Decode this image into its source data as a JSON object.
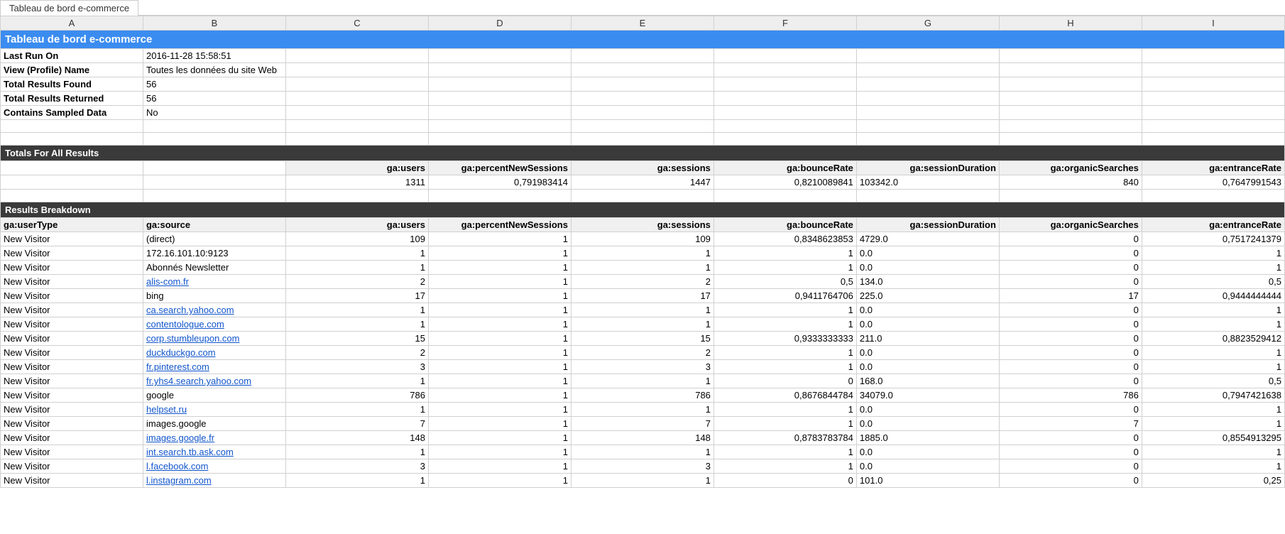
{
  "tab": "Tableau de bord e-commerce",
  "columns": [
    "A",
    "B",
    "C",
    "D",
    "E",
    "F",
    "G",
    "H",
    "I"
  ],
  "title": "Tableau de bord e-commerce",
  "meta": [
    {
      "label": "Last Run On",
      "value": "2016-11-28 15:58:51"
    },
    {
      "label": "View (Profile) Name",
      "value": "Toutes les données du site Web"
    },
    {
      "label": "Total Results Found",
      "value": "56"
    },
    {
      "label": "Total Results Returned",
      "value": "56"
    },
    {
      "label": "Contains Sampled Data",
      "value": "No"
    }
  ],
  "totals_header": "Totals For All Results",
  "metric_headers": [
    "ga:users",
    "ga:percentNewSessions",
    "ga:sessions",
    "ga:bounceRate",
    "ga:sessionDuration",
    "ga:organicSearches",
    "ga:entranceRate"
  ],
  "totals_values": [
    "1311",
    "0,791983414",
    "1447",
    "0,8210089841",
    "103342.0",
    "840",
    "0,7647991543"
  ],
  "breakdown_header": "Results Breakdown",
  "dim_headers": [
    "ga:userType",
    "ga:source"
  ],
  "rows": [
    {
      "ut": "New Visitor",
      "src": "(direct)",
      "link": false,
      "v": [
        "109",
        "1",
        "109",
        "0,8348623853",
        "4729.0",
        "0",
        "0,7517241379"
      ]
    },
    {
      "ut": "New Visitor",
      "src": "172.16.101.10:9123",
      "link": false,
      "v": [
        "1",
        "1",
        "1",
        "1",
        "0.0",
        "0",
        "1"
      ]
    },
    {
      "ut": "New Visitor",
      "src": "Abonnés Newsletter",
      "link": false,
      "v": [
        "1",
        "1",
        "1",
        "1",
        "0.0",
        "0",
        "1"
      ]
    },
    {
      "ut": "New Visitor",
      "src": "alis-com.fr",
      "link": true,
      "v": [
        "2",
        "1",
        "2",
        "0,5",
        "134.0",
        "0",
        "0,5"
      ]
    },
    {
      "ut": "New Visitor",
      "src": "bing",
      "link": false,
      "v": [
        "17",
        "1",
        "17",
        "0,9411764706",
        "225.0",
        "17",
        "0,9444444444"
      ]
    },
    {
      "ut": "New Visitor",
      "src": "ca.search.yahoo.com",
      "link": true,
      "v": [
        "1",
        "1",
        "1",
        "1",
        "0.0",
        "0",
        "1"
      ]
    },
    {
      "ut": "New Visitor",
      "src": "contentologue.com",
      "link": true,
      "v": [
        "1",
        "1",
        "1",
        "1",
        "0.0",
        "0",
        "1"
      ]
    },
    {
      "ut": "New Visitor",
      "src": "corp.stumbleupon.com",
      "link": true,
      "v": [
        "15",
        "1",
        "15",
        "0,9333333333",
        "211.0",
        "0",
        "0,8823529412"
      ]
    },
    {
      "ut": "New Visitor",
      "src": "duckduckgo.com",
      "link": true,
      "v": [
        "2",
        "1",
        "2",
        "1",
        "0.0",
        "0",
        "1"
      ]
    },
    {
      "ut": "New Visitor",
      "src": "fr.pinterest.com",
      "link": true,
      "v": [
        "3",
        "1",
        "3",
        "1",
        "0.0",
        "0",
        "1"
      ]
    },
    {
      "ut": "New Visitor",
      "src": "fr.yhs4.search.yahoo.com",
      "link": true,
      "v": [
        "1",
        "1",
        "1",
        "0",
        "168.0",
        "0",
        "0,5"
      ]
    },
    {
      "ut": "New Visitor",
      "src": "google",
      "link": false,
      "v": [
        "786",
        "1",
        "786",
        "0,8676844784",
        "34079.0",
        "786",
        "0,7947421638"
      ]
    },
    {
      "ut": "New Visitor",
      "src": "helpset.ru",
      "link": true,
      "v": [
        "1",
        "1",
        "1",
        "1",
        "0.0",
        "0",
        "1"
      ]
    },
    {
      "ut": "New Visitor",
      "src": "images.google",
      "link": false,
      "v": [
        "7",
        "1",
        "7",
        "1",
        "0.0",
        "7",
        "1"
      ]
    },
    {
      "ut": "New Visitor",
      "src": "images.google.fr",
      "link": true,
      "v": [
        "148",
        "1",
        "148",
        "0,8783783784",
        "1885.0",
        "0",
        "0,8554913295"
      ]
    },
    {
      "ut": "New Visitor",
      "src": "int.search.tb.ask.com",
      "link": true,
      "v": [
        "1",
        "1",
        "1",
        "1",
        "0.0",
        "0",
        "1"
      ]
    },
    {
      "ut": "New Visitor",
      "src": "l.facebook.com",
      "link": true,
      "v": [
        "3",
        "1",
        "3",
        "1",
        "0.0",
        "0",
        "1"
      ]
    },
    {
      "ut": "New Visitor",
      "src": "l.instagram.com",
      "link": true,
      "v": [
        "1",
        "1",
        "1",
        "0",
        "101.0",
        "0",
        "0,25"
      ]
    }
  ]
}
